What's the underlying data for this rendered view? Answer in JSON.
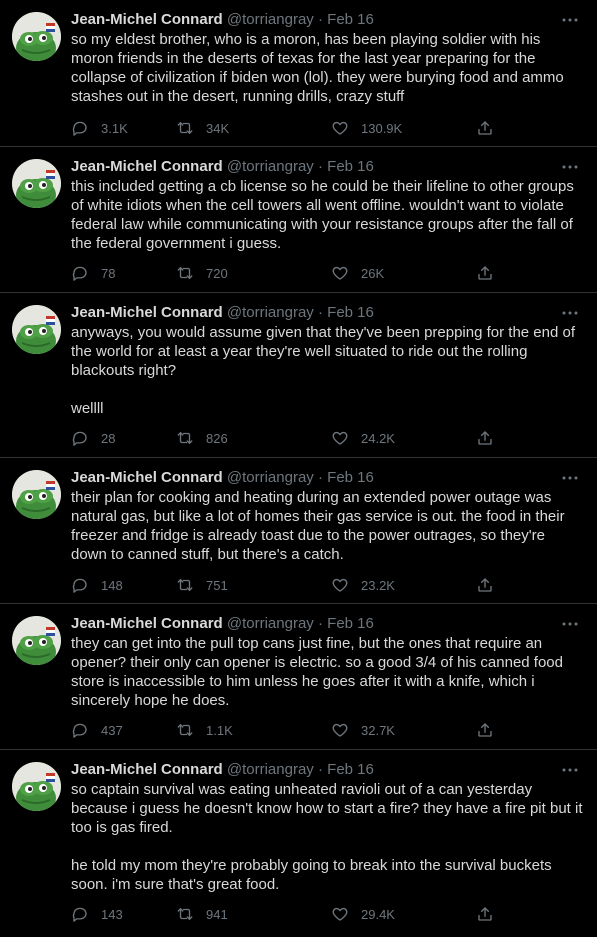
{
  "author": {
    "name": "Jean-Michel Connard",
    "handle": "@torriangray",
    "separator": "·"
  },
  "icons": {
    "avatar": "frog-avatar-icon",
    "more": "more-dots-icon",
    "reply": "reply-bubble-icon",
    "retweet": "retweet-icon",
    "like": "heart-icon",
    "share": "share-icon"
  },
  "colors": {
    "background": "#000000",
    "text": "#d9d9d9",
    "muted": "#6e767d",
    "divider": "#2f3336"
  },
  "tweets": [
    {
      "date": "Feb 16",
      "paragraphs": [
        "so my eldest brother, who is a moron, has been playing soldier with his moron friends in the deserts of texas for the last year preparing for the collapse of civilization if biden won (lol). they were burying food and ammo stashes out in the desert, running drills, crazy stuff"
      ],
      "replies": "3.1K",
      "retweets": "34K",
      "likes": "130.9K"
    },
    {
      "date": "Feb 16",
      "paragraphs": [
        "this included getting a cb license so he could be their lifeline to other groups of white idiots when the cell towers all went offline. wouldn't want to violate federal law while communicating with your resistance groups after the fall of the federal government i guess."
      ],
      "replies": "78",
      "retweets": "720",
      "likes": "26K"
    },
    {
      "date": "Feb 16",
      "paragraphs": [
        "anyways, you would assume given that they've been prepping for the end of the world for at least a year they're well situated to ride out the rolling blackouts right?",
        "wellll"
      ],
      "replies": "28",
      "retweets": "826",
      "likes": "24.2K"
    },
    {
      "date": "Feb 16",
      "paragraphs": [
        "their plan for cooking and heating during an extended power outage was natural gas, but like a lot of homes their gas service is out. the food in their freezer and fridge is already toast due to the power outrages, so they're down to canned stuff, but there's a catch."
      ],
      "replies": "148",
      "retweets": "751",
      "likes": "23.2K"
    },
    {
      "date": "Feb 16",
      "paragraphs": [
        "they can get into the pull top cans just fine, but the ones that require an opener? their only can opener is electric. so a good 3/4 of his canned food store is inaccessible to him unless he goes after it with a knife, which i sincerely hope he does."
      ],
      "replies": "437",
      "retweets": "1.1K",
      "likes": "32.7K"
    },
    {
      "date": "Feb 16",
      "paragraphs": [
        "so captain survival was eating unheated ravioli out of a can yesterday because i guess he doesn't know how to start a fire? they have a fire pit but it too is gas fired.",
        "he told my mom they're probably going to break into the survival buckets soon. i'm sure that's great food."
      ],
      "replies": "143",
      "retweets": "941",
      "likes": "29.4K"
    }
  ]
}
